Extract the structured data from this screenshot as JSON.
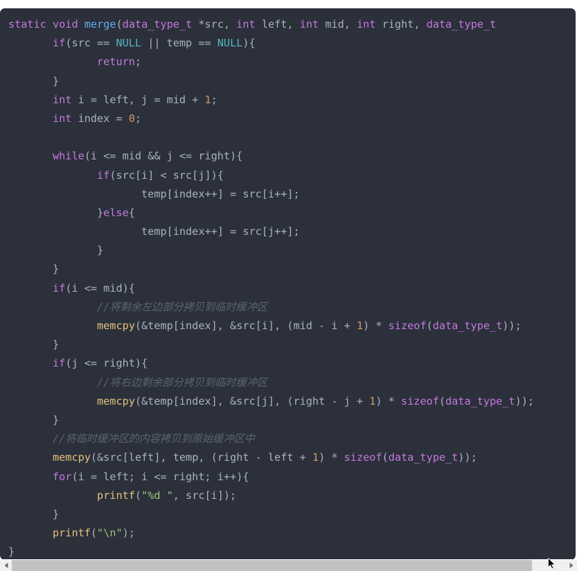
{
  "window": {
    "kind": "code-snippet-viewer",
    "language": "C",
    "background": "#2b303b",
    "page_background": "#ffffff"
  },
  "theme": {
    "background": "#2b303b",
    "foreground": "#abb2bf",
    "keyword": "#c678dd",
    "function_def": "#61afef",
    "function_call": "#e5c07b",
    "type": "#c678dd",
    "constant": "#56b6c2",
    "number": "#d19a66",
    "string": "#98c379",
    "comment": "#5c6370",
    "scrollbar_track": "#f0f0f0",
    "scrollbar_thumb": "#c2c2c2"
  },
  "code": {
    "truncated_right": true,
    "lines": [
      {
        "n": 1,
        "indent": 0,
        "tokens": [
          {
            "t": "static",
            "c": "kw"
          },
          {
            "t": " ",
            "c": "pun"
          },
          {
            "t": "void",
            "c": "kw"
          },
          {
            "t": " ",
            "c": "pun"
          },
          {
            "t": "merge",
            "c": "fn"
          },
          {
            "t": "(",
            "c": "pun"
          },
          {
            "t": "data_type_t",
            "c": "type"
          },
          {
            "t": " *src, ",
            "c": "pun"
          },
          {
            "t": "int",
            "c": "kw"
          },
          {
            "t": " left, ",
            "c": "pun"
          },
          {
            "t": "int",
            "c": "kw"
          },
          {
            "t": " mid, ",
            "c": "pun"
          },
          {
            "t": "int",
            "c": "kw"
          },
          {
            "t": " right, ",
            "c": "pun"
          },
          {
            "t": "data_type_t",
            "c": "type"
          }
        ]
      },
      {
        "n": 2,
        "indent": 1,
        "tokens": [
          {
            "t": "if",
            "c": "kw"
          },
          {
            "t": "(src == ",
            "c": "pun"
          },
          {
            "t": "NULL",
            "c": "cst"
          },
          {
            "t": " || temp == ",
            "c": "pun"
          },
          {
            "t": "NULL",
            "c": "cst"
          },
          {
            "t": "){",
            "c": "pun"
          }
        ]
      },
      {
        "n": 3,
        "indent": 2,
        "tokens": [
          {
            "t": "return",
            "c": "kw"
          },
          {
            "t": ";",
            "c": "pun"
          }
        ]
      },
      {
        "n": 4,
        "indent": 1,
        "tokens": [
          {
            "t": "}",
            "c": "pun"
          }
        ]
      },
      {
        "n": 5,
        "indent": 1,
        "tokens": [
          {
            "t": "int",
            "c": "kw"
          },
          {
            "t": " i = left, j = mid + ",
            "c": "pun"
          },
          {
            "t": "1",
            "c": "num"
          },
          {
            "t": ";",
            "c": "pun"
          }
        ]
      },
      {
        "n": 6,
        "indent": 1,
        "tokens": [
          {
            "t": "int",
            "c": "kw"
          },
          {
            "t": " index = ",
            "c": "pun"
          },
          {
            "t": "0",
            "c": "num"
          },
          {
            "t": ";",
            "c": "pun"
          }
        ]
      },
      {
        "n": 7,
        "indent": 0,
        "tokens": []
      },
      {
        "n": 8,
        "indent": 1,
        "tokens": [
          {
            "t": "while",
            "c": "kw"
          },
          {
            "t": "(i <= mid && j <= right){",
            "c": "pun"
          }
        ]
      },
      {
        "n": 9,
        "indent": 2,
        "tokens": [
          {
            "t": "if",
            "c": "kw"
          },
          {
            "t": "(src[i] < src[j]){",
            "c": "pun"
          }
        ]
      },
      {
        "n": 10,
        "indent": 3,
        "tokens": [
          {
            "t": "temp[index++] = src[i++];",
            "c": "pun"
          }
        ]
      },
      {
        "n": 11,
        "indent": 2,
        "tokens": [
          {
            "t": "}",
            "c": "pun"
          },
          {
            "t": "else",
            "c": "kw"
          },
          {
            "t": "{",
            "c": "pun"
          }
        ]
      },
      {
        "n": 12,
        "indent": 3,
        "tokens": [
          {
            "t": "temp[index++] = src[j++];",
            "c": "pun"
          }
        ]
      },
      {
        "n": 13,
        "indent": 2,
        "tokens": [
          {
            "t": "}",
            "c": "pun"
          }
        ]
      },
      {
        "n": 14,
        "indent": 1,
        "tokens": [
          {
            "t": "}",
            "c": "pun"
          }
        ]
      },
      {
        "n": 15,
        "indent": 1,
        "tokens": [
          {
            "t": "if",
            "c": "kw"
          },
          {
            "t": "(i <= mid){",
            "c": "pun"
          }
        ]
      },
      {
        "n": 16,
        "indent": 2,
        "tokens": [
          {
            "t": "//将剩余左边部分拷贝到临时缓冲区",
            "c": "cmt"
          }
        ]
      },
      {
        "n": 17,
        "indent": 2,
        "tokens": [
          {
            "t": "memcpy",
            "c": "call"
          },
          {
            "t": "(&temp[index], &src[i], (mid - i + ",
            "c": "pun"
          },
          {
            "t": "1",
            "c": "num"
          },
          {
            "t": ") * ",
            "c": "pun"
          },
          {
            "t": "sizeof",
            "c": "type"
          },
          {
            "t": "(",
            "c": "pun"
          },
          {
            "t": "data_type_t",
            "c": "type"
          },
          {
            "t": "));",
            "c": "pun"
          }
        ]
      },
      {
        "n": 18,
        "indent": 1,
        "tokens": [
          {
            "t": "}",
            "c": "pun"
          }
        ]
      },
      {
        "n": 19,
        "indent": 1,
        "tokens": [
          {
            "t": "if",
            "c": "kw"
          },
          {
            "t": "(j <= right){",
            "c": "pun"
          }
        ]
      },
      {
        "n": 20,
        "indent": 2,
        "tokens": [
          {
            "t": "//将右边剩余部分拷贝到临时缓冲区",
            "c": "cmt"
          }
        ]
      },
      {
        "n": 21,
        "indent": 2,
        "tokens": [
          {
            "t": "memcpy",
            "c": "call"
          },
          {
            "t": "(&temp[index], &src[j], (right - j + ",
            "c": "pun"
          },
          {
            "t": "1",
            "c": "num"
          },
          {
            "t": ") * ",
            "c": "pun"
          },
          {
            "t": "sizeof",
            "c": "type"
          },
          {
            "t": "(",
            "c": "pun"
          },
          {
            "t": "data_type_t",
            "c": "type"
          },
          {
            "t": "));",
            "c": "pun"
          }
        ]
      },
      {
        "n": 22,
        "indent": 1,
        "tokens": [
          {
            "t": "}",
            "c": "pun"
          }
        ]
      },
      {
        "n": 23,
        "indent": 1,
        "tokens": [
          {
            "t": "//将临时缓冲区的内容拷贝到原始缓冲区中",
            "c": "cmt"
          }
        ]
      },
      {
        "n": 24,
        "indent": 1,
        "tokens": [
          {
            "t": "memcpy",
            "c": "call"
          },
          {
            "t": "(&src[left], temp, (right - left + ",
            "c": "pun"
          },
          {
            "t": "1",
            "c": "num"
          },
          {
            "t": ") * ",
            "c": "pun"
          },
          {
            "t": "sizeof",
            "c": "type"
          },
          {
            "t": "(",
            "c": "pun"
          },
          {
            "t": "data_type_t",
            "c": "type"
          },
          {
            "t": "));",
            "c": "pun"
          }
        ]
      },
      {
        "n": 25,
        "indent": 1,
        "tokens": [
          {
            "t": "for",
            "c": "kw"
          },
          {
            "t": "(i = left; i <= right; i++){",
            "c": "pun"
          }
        ]
      },
      {
        "n": 26,
        "indent": 2,
        "tokens": [
          {
            "t": "printf",
            "c": "call"
          },
          {
            "t": "(",
            "c": "pun"
          },
          {
            "t": "\"%d \"",
            "c": "str"
          },
          {
            "t": ", src[i]);",
            "c": "pun"
          }
        ]
      },
      {
        "n": 27,
        "indent": 1,
        "tokens": [
          {
            "t": "}",
            "c": "pun"
          }
        ]
      },
      {
        "n": 28,
        "indent": 1,
        "tokens": [
          {
            "t": "printf",
            "c": "call"
          },
          {
            "t": "(",
            "c": "pun"
          },
          {
            "t": "\"\\n\"",
            "c": "str"
          },
          {
            "t": ");",
            "c": "pun"
          }
        ]
      },
      {
        "n": 29,
        "indent": 0,
        "tokens": [
          {
            "t": "}",
            "c": "pun"
          }
        ]
      }
    ]
  },
  "scrollbar": {
    "orientation": "horizontal",
    "left_arrow": "◀",
    "right_arrow": "▶",
    "thumb_width_percent": 94,
    "scroll_position_percent": 0
  }
}
